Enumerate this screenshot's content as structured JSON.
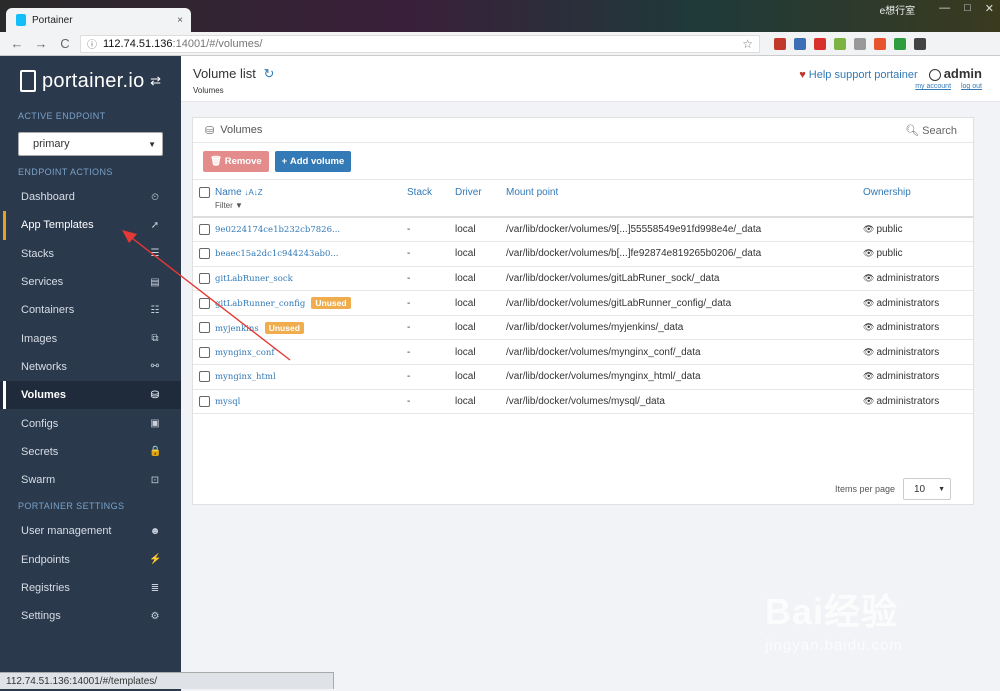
{
  "browser": {
    "tab_title": "Portainer",
    "tab_close": "×",
    "window_user": "e想行室",
    "win_controls": [
      "—",
      "□",
      "✕"
    ],
    "nav": [
      "←",
      "→",
      "C"
    ],
    "url_host": "112.74.51.136",
    "url_path": ":14001/#/volumes/",
    "status_url": "112.74.51.136:14001/#/templates/",
    "extension_colors": [
      "#c0392b",
      "#3d6fb6",
      "#d9302c",
      "#7cb342",
      "#999999",
      "#e8532f",
      "#2e9d3f",
      "#444444"
    ]
  },
  "sidebar": {
    "logo": "portainer.io",
    "swap_icon": "⇄",
    "active_endpoint_label": "ACTIVE ENDPOINT",
    "endpoint_value": "primary",
    "endpoint_actions_label": "ENDPOINT ACTIONS",
    "items": [
      {
        "label": "Dashboard",
        "icon": "⏲"
      },
      {
        "label": "App Templates",
        "icon": "➚"
      },
      {
        "label": "Stacks",
        "icon": "☰"
      },
      {
        "label": "Services",
        "icon": "▤"
      },
      {
        "label": "Containers",
        "icon": "☷"
      },
      {
        "label": "Images",
        "icon": "⧉"
      },
      {
        "label": "Networks",
        "icon": "⚯"
      },
      {
        "label": "Volumes",
        "icon": "⛁"
      },
      {
        "label": "Configs",
        "icon": "▣"
      },
      {
        "label": "Secrets",
        "icon": "🔒"
      },
      {
        "label": "Swarm",
        "icon": "⊡"
      }
    ],
    "settings_label": "PORTAINER SETTINGS",
    "settings_items": [
      {
        "label": "User management",
        "icon": "☻"
      },
      {
        "label": "Endpoints",
        "icon": "⚡"
      },
      {
        "label": "Registries",
        "icon": "≣"
      },
      {
        "label": "Settings",
        "icon": "⚙"
      }
    ]
  },
  "header": {
    "title": "Volume list",
    "refresh_icon": "↻",
    "breadcrumb": "Volumes",
    "help": "Help support portainer",
    "heart": "♥",
    "user": "admin",
    "my_account": "my account",
    "log_out": "log out"
  },
  "panel": {
    "title": "Volumes",
    "search": "Search",
    "remove": "Remove",
    "add": "Add volume",
    "columns": {
      "name": "Name",
      "sort": "↓A↓Z",
      "filter": "Filter",
      "stack": "Stack",
      "driver": "Driver",
      "mount": "Mount point",
      "ownership": "Ownership"
    },
    "rows": [
      {
        "name": "9e0224174ce1b232cb7826...",
        "badge": "",
        "stack": "-",
        "driver": "local",
        "mount": "/var/lib/docker/volumes/9[...]55558549e91fd998e4e/_data",
        "owner": "public"
      },
      {
        "name": "beaec15a2dc1c944243ab0...",
        "badge": "",
        "stack": "-",
        "driver": "local",
        "mount": "/var/lib/docker/volumes/b[...]fe92874e819265b0206/_data",
        "owner": "public"
      },
      {
        "name": "gitLabRuner_sock",
        "badge": "",
        "stack": "-",
        "driver": "local",
        "mount": "/var/lib/docker/volumes/gitLabRuner_sock/_data",
        "owner": "administrators"
      },
      {
        "name": "gitLabRunner_config",
        "badge": "Unused",
        "stack": "-",
        "driver": "local",
        "mount": "/var/lib/docker/volumes/gitLabRunner_config/_data",
        "owner": "administrators"
      },
      {
        "name": "myjenkins",
        "badge": "Unused",
        "stack": "-",
        "driver": "local",
        "mount": "/var/lib/docker/volumes/myjenkins/_data",
        "owner": "administrators"
      },
      {
        "name": "mynginx_conf",
        "badge": "",
        "stack": "-",
        "driver": "local",
        "mount": "/var/lib/docker/volumes/mynginx_conf/_data",
        "owner": "administrators"
      },
      {
        "name": "mynginx_html",
        "badge": "",
        "stack": "-",
        "driver": "local",
        "mount": "/var/lib/docker/volumes/mynginx_html/_data",
        "owner": "administrators"
      },
      {
        "name": "mysql",
        "badge": "",
        "stack": "-",
        "driver": "local",
        "mount": "/var/lib/docker/volumes/mysql/_data",
        "owner": "administrators"
      }
    ],
    "items_per_page_label": "Items per page",
    "items_per_page": "10"
  },
  "watermark": {
    "big": "Bai经验",
    "small": "jingyan.baidu.com"
  }
}
